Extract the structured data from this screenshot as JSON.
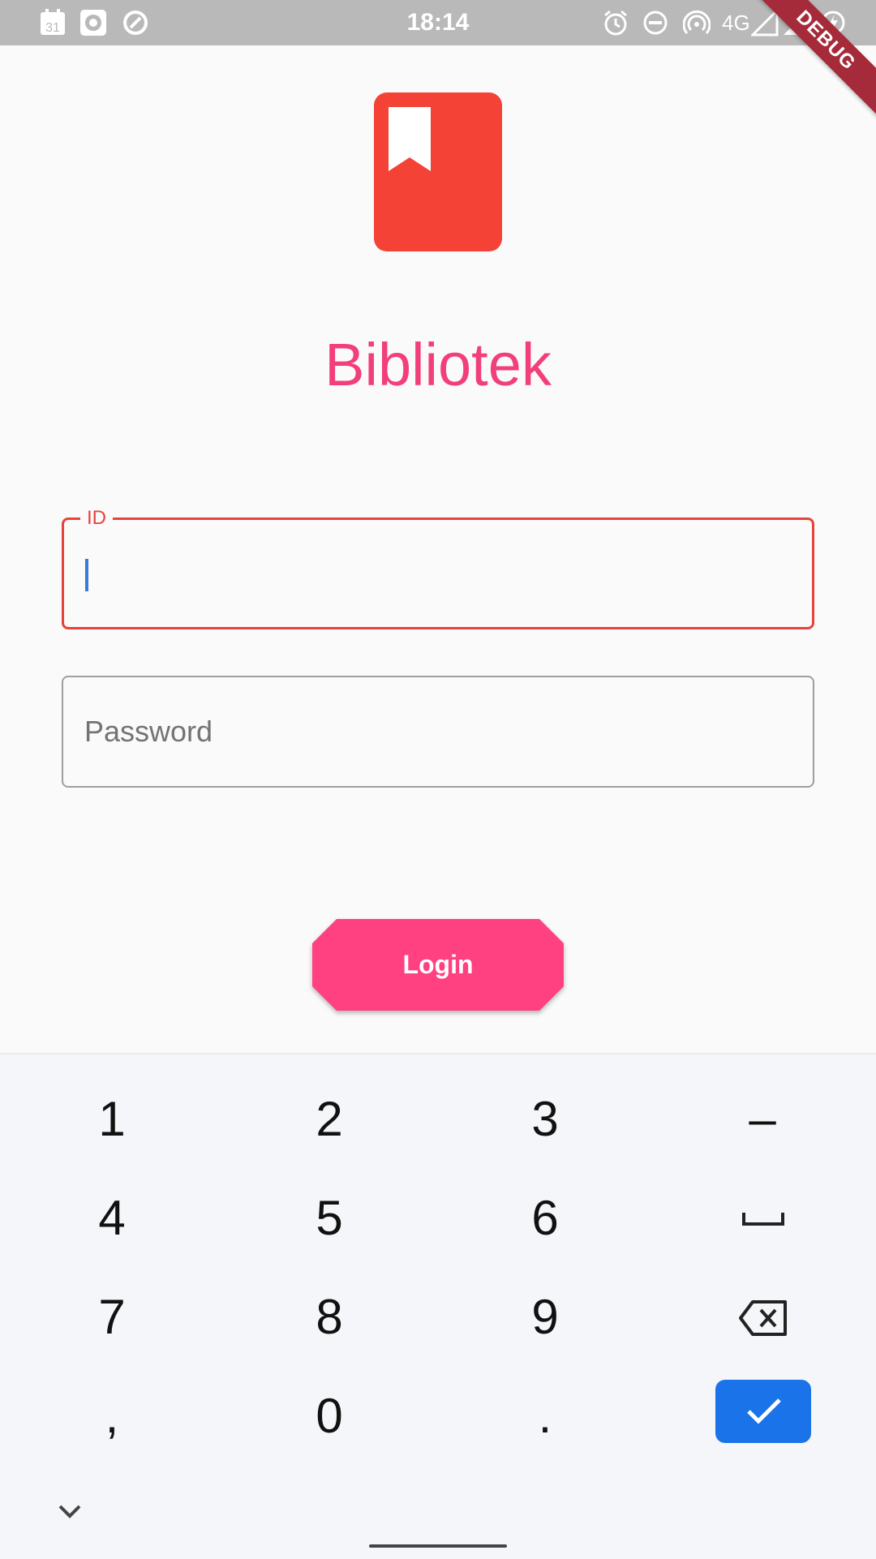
{
  "status_bar": {
    "time": "18:14",
    "calendar_day": "31",
    "network": "4G",
    "left_icons": [
      "calendar-icon",
      "record-icon",
      "sync-icon"
    ],
    "right_icons": [
      "alarm-icon",
      "do-not-disturb-icon",
      "hotspot-icon",
      "signal-icon",
      "signal-icon",
      "battery-saver-icon"
    ]
  },
  "debug_banner": "DEBUG",
  "app": {
    "logo_icon": "book-bookmark-icon",
    "title": "Bibliotek"
  },
  "form": {
    "id_label": "ID",
    "id_value": "",
    "password_placeholder": "Password",
    "login_label": "Login"
  },
  "keyboard": {
    "rows": [
      [
        "1",
        "2",
        "3",
        "–"
      ],
      [
        "4",
        "5",
        "6",
        "space"
      ],
      [
        "7",
        "8",
        "9",
        "backspace"
      ],
      [
        ",",
        "0",
        ".",
        "enter"
      ]
    ],
    "collapse_icon": "chevron-down-icon"
  },
  "colors": {
    "accent": "#ff4081",
    "title": "#f23f7a",
    "error": "#e8423c",
    "logo": "#f44336",
    "keyboard_enter": "#1a73e8"
  }
}
